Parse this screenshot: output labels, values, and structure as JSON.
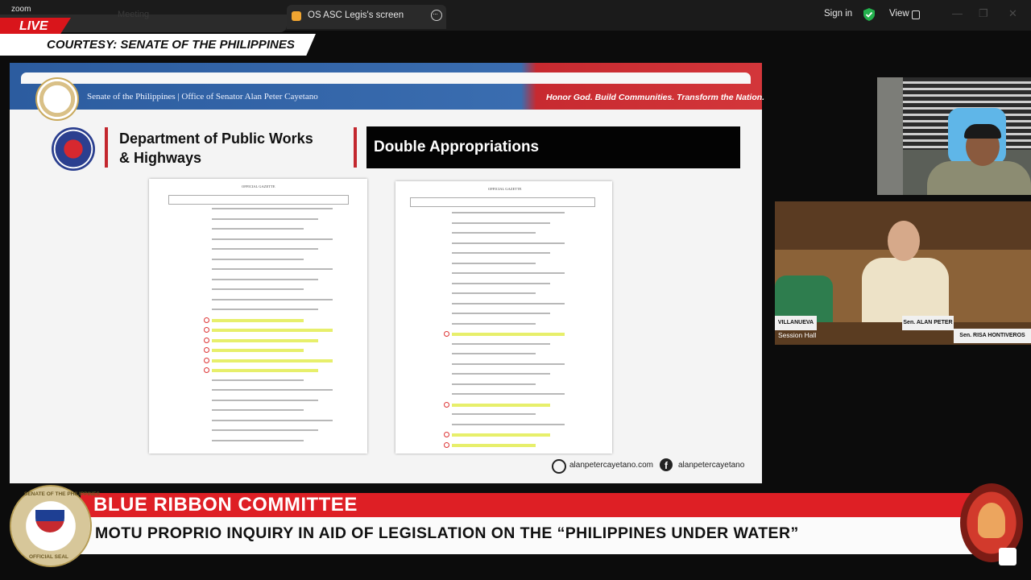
{
  "zoom": {
    "app_name": "zoom",
    "meeting_tab": "Meeting",
    "share_tab": "OS ASC Legis's screen",
    "sign_in": "Sign in",
    "view": "View",
    "window_controls": [
      "—",
      "❐",
      "✕"
    ]
  },
  "broadcast": {
    "live": "LIVE",
    "courtesy": "COURTESY: SENATE OF THE PHILIPPINES",
    "committee": "BLUE RIBBON COMMITTEE",
    "inquiry": "MOTU PROPRIO INQUIRY IN AID OF LEGISLATION ON THE “PHILIPPINES UNDER WATER”",
    "seal_top": "SENATE OF THE PHILIPPINES",
    "seal_bottom": "OFFICIAL SEAL"
  },
  "slide": {
    "office": "Senate of the Philippines | Office of Senator Alan Peter Cayetano",
    "motto": "Honor God. Build Communities. Transform the Nation.",
    "department_line1": "Department of Public Works",
    "department_line2": "& Highways",
    "heading": "Double Appropriations",
    "doc_left_header": "OFFICIAL GAZETTE",
    "doc_right_header": "OFFICIAL GAZETTE",
    "social_web": "alanpetercayetano.com",
    "social_fb": "alanpetercayetano"
  },
  "participants": {
    "session_label": "Session Hall",
    "plaques": [
      "VILLANUEVA",
      "Sen. ALAN PETER",
      "Sen. RISA HONTIVEROS"
    ]
  },
  "colors": {
    "live_red": "#d9151b",
    "banner_red": "#de1f25",
    "header_blue": "#2c5c9f",
    "highlight_yellow": "#e7ef6b"
  }
}
